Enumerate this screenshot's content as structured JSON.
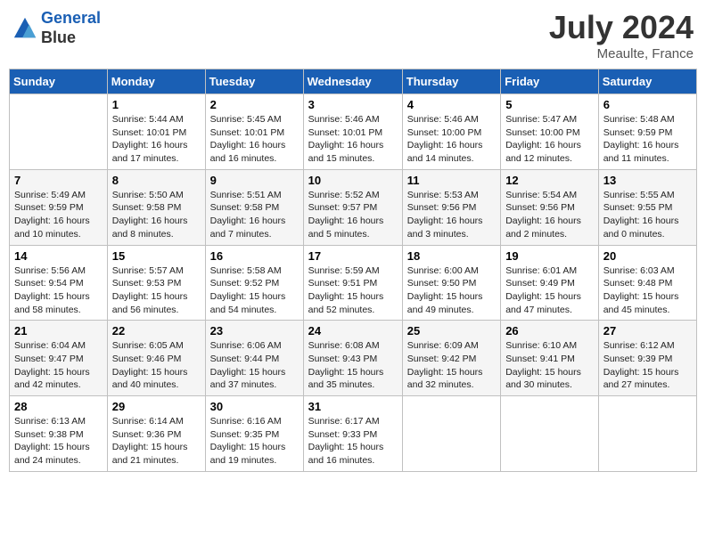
{
  "header": {
    "logo_line1": "General",
    "logo_line2": "Blue",
    "month": "July 2024",
    "location": "Meaulte, France"
  },
  "days_of_week": [
    "Sunday",
    "Monday",
    "Tuesday",
    "Wednesday",
    "Thursday",
    "Friday",
    "Saturday"
  ],
  "weeks": [
    [
      {
        "day": "",
        "sunrise": "",
        "sunset": "",
        "daylight": ""
      },
      {
        "day": "1",
        "sunrise": "Sunrise: 5:44 AM",
        "sunset": "Sunset: 10:01 PM",
        "daylight": "Daylight: 16 hours and 17 minutes."
      },
      {
        "day": "2",
        "sunrise": "Sunrise: 5:45 AM",
        "sunset": "Sunset: 10:01 PM",
        "daylight": "Daylight: 16 hours and 16 minutes."
      },
      {
        "day": "3",
        "sunrise": "Sunrise: 5:46 AM",
        "sunset": "Sunset: 10:01 PM",
        "daylight": "Daylight: 16 hours and 15 minutes."
      },
      {
        "day": "4",
        "sunrise": "Sunrise: 5:46 AM",
        "sunset": "Sunset: 10:00 PM",
        "daylight": "Daylight: 16 hours and 14 minutes."
      },
      {
        "day": "5",
        "sunrise": "Sunrise: 5:47 AM",
        "sunset": "Sunset: 10:00 PM",
        "daylight": "Daylight: 16 hours and 12 minutes."
      },
      {
        "day": "6",
        "sunrise": "Sunrise: 5:48 AM",
        "sunset": "Sunset: 9:59 PM",
        "daylight": "Daylight: 16 hours and 11 minutes."
      }
    ],
    [
      {
        "day": "7",
        "sunrise": "Sunrise: 5:49 AM",
        "sunset": "Sunset: 9:59 PM",
        "daylight": "Daylight: 16 hours and 10 minutes."
      },
      {
        "day": "8",
        "sunrise": "Sunrise: 5:50 AM",
        "sunset": "Sunset: 9:58 PM",
        "daylight": "Daylight: 16 hours and 8 minutes."
      },
      {
        "day": "9",
        "sunrise": "Sunrise: 5:51 AM",
        "sunset": "Sunset: 9:58 PM",
        "daylight": "Daylight: 16 hours and 7 minutes."
      },
      {
        "day": "10",
        "sunrise": "Sunrise: 5:52 AM",
        "sunset": "Sunset: 9:57 PM",
        "daylight": "Daylight: 16 hours and 5 minutes."
      },
      {
        "day": "11",
        "sunrise": "Sunrise: 5:53 AM",
        "sunset": "Sunset: 9:56 PM",
        "daylight": "Daylight: 16 hours and 3 minutes."
      },
      {
        "day": "12",
        "sunrise": "Sunrise: 5:54 AM",
        "sunset": "Sunset: 9:56 PM",
        "daylight": "Daylight: 16 hours and 2 minutes."
      },
      {
        "day": "13",
        "sunrise": "Sunrise: 5:55 AM",
        "sunset": "Sunset: 9:55 PM",
        "daylight": "Daylight: 16 hours and 0 minutes."
      }
    ],
    [
      {
        "day": "14",
        "sunrise": "Sunrise: 5:56 AM",
        "sunset": "Sunset: 9:54 PM",
        "daylight": "Daylight: 15 hours and 58 minutes."
      },
      {
        "day": "15",
        "sunrise": "Sunrise: 5:57 AM",
        "sunset": "Sunset: 9:53 PM",
        "daylight": "Daylight: 15 hours and 56 minutes."
      },
      {
        "day": "16",
        "sunrise": "Sunrise: 5:58 AM",
        "sunset": "Sunset: 9:52 PM",
        "daylight": "Daylight: 15 hours and 54 minutes."
      },
      {
        "day": "17",
        "sunrise": "Sunrise: 5:59 AM",
        "sunset": "Sunset: 9:51 PM",
        "daylight": "Daylight: 15 hours and 52 minutes."
      },
      {
        "day": "18",
        "sunrise": "Sunrise: 6:00 AM",
        "sunset": "Sunset: 9:50 PM",
        "daylight": "Daylight: 15 hours and 49 minutes."
      },
      {
        "day": "19",
        "sunrise": "Sunrise: 6:01 AM",
        "sunset": "Sunset: 9:49 PM",
        "daylight": "Daylight: 15 hours and 47 minutes."
      },
      {
        "day": "20",
        "sunrise": "Sunrise: 6:03 AM",
        "sunset": "Sunset: 9:48 PM",
        "daylight": "Daylight: 15 hours and 45 minutes."
      }
    ],
    [
      {
        "day": "21",
        "sunrise": "Sunrise: 6:04 AM",
        "sunset": "Sunset: 9:47 PM",
        "daylight": "Daylight: 15 hours and 42 minutes."
      },
      {
        "day": "22",
        "sunrise": "Sunrise: 6:05 AM",
        "sunset": "Sunset: 9:46 PM",
        "daylight": "Daylight: 15 hours and 40 minutes."
      },
      {
        "day": "23",
        "sunrise": "Sunrise: 6:06 AM",
        "sunset": "Sunset: 9:44 PM",
        "daylight": "Daylight: 15 hours and 37 minutes."
      },
      {
        "day": "24",
        "sunrise": "Sunrise: 6:08 AM",
        "sunset": "Sunset: 9:43 PM",
        "daylight": "Daylight: 15 hours and 35 minutes."
      },
      {
        "day": "25",
        "sunrise": "Sunrise: 6:09 AM",
        "sunset": "Sunset: 9:42 PM",
        "daylight": "Daylight: 15 hours and 32 minutes."
      },
      {
        "day": "26",
        "sunrise": "Sunrise: 6:10 AM",
        "sunset": "Sunset: 9:41 PM",
        "daylight": "Daylight: 15 hours and 30 minutes."
      },
      {
        "day": "27",
        "sunrise": "Sunrise: 6:12 AM",
        "sunset": "Sunset: 9:39 PM",
        "daylight": "Daylight: 15 hours and 27 minutes."
      }
    ],
    [
      {
        "day": "28",
        "sunrise": "Sunrise: 6:13 AM",
        "sunset": "Sunset: 9:38 PM",
        "daylight": "Daylight: 15 hours and 24 minutes."
      },
      {
        "day": "29",
        "sunrise": "Sunrise: 6:14 AM",
        "sunset": "Sunset: 9:36 PM",
        "daylight": "Daylight: 15 hours and 21 minutes."
      },
      {
        "day": "30",
        "sunrise": "Sunrise: 6:16 AM",
        "sunset": "Sunset: 9:35 PM",
        "daylight": "Daylight: 15 hours and 19 minutes."
      },
      {
        "day": "31",
        "sunrise": "Sunrise: 6:17 AM",
        "sunset": "Sunset: 9:33 PM",
        "daylight": "Daylight: 15 hours and 16 minutes."
      },
      {
        "day": "",
        "sunrise": "",
        "sunset": "",
        "daylight": ""
      },
      {
        "day": "",
        "sunrise": "",
        "sunset": "",
        "daylight": ""
      },
      {
        "day": "",
        "sunrise": "",
        "sunset": "",
        "daylight": ""
      }
    ]
  ]
}
